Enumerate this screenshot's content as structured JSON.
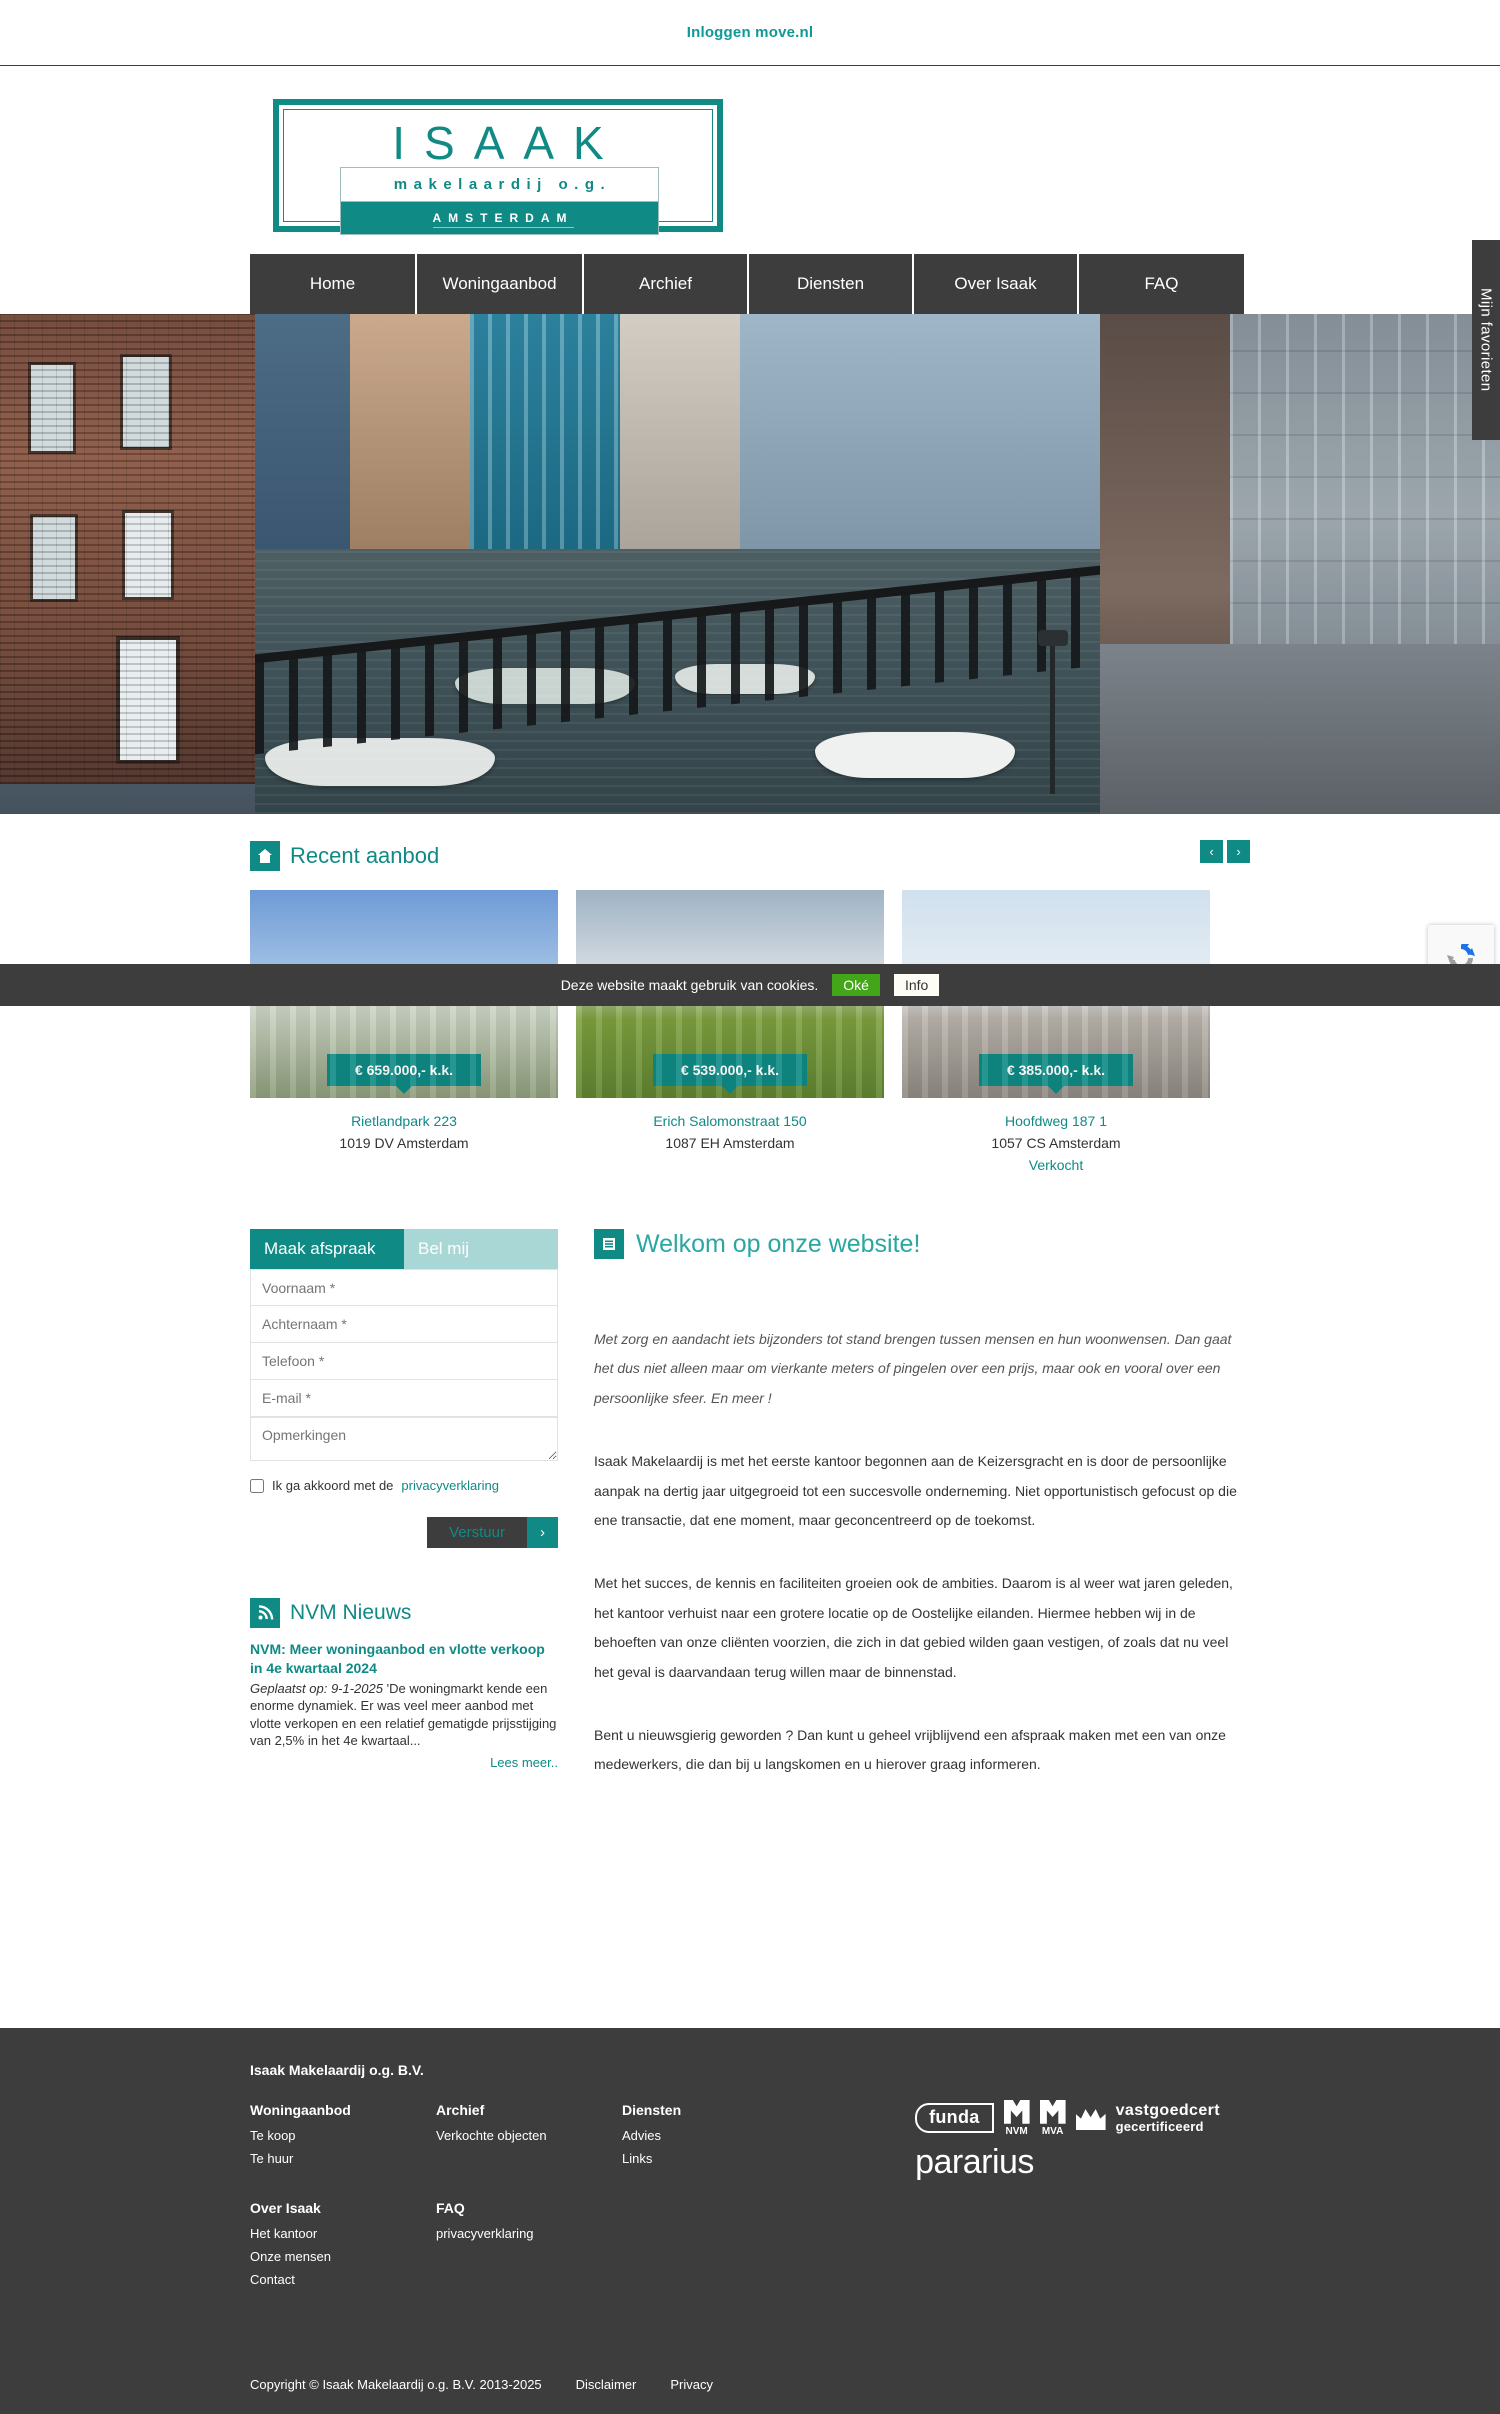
{
  "topbar": {
    "login_label": "Inloggen move.nl"
  },
  "logo": {
    "name": "ISAAK",
    "subtitle": "makelaardij o.g.",
    "city": "AMSTERDAM"
  },
  "nav": {
    "items": [
      {
        "label": "Home",
        "name": "home"
      },
      {
        "label": "Woningaanbod",
        "name": "woningaanbod"
      },
      {
        "label": "Archief",
        "name": "archief"
      },
      {
        "label": "Diensten",
        "name": "diensten"
      },
      {
        "label": "Over Isaak",
        "name": "over-isaak"
      },
      {
        "label": "FAQ",
        "name": "faq"
      }
    ],
    "favorites_label": "Mijn favorieten"
  },
  "cookiebar": {
    "message": "Deze website maakt gebruik van cookies.",
    "ok_label": "Oké",
    "info_label": "Info"
  },
  "recent": {
    "title": "Recent aanbod",
    "icon": "house-icon",
    "prev_label": "‹",
    "next_label": "›",
    "cards": [
      {
        "price": "€ 659.000,- k.k.",
        "address": "Rietlandpark 223",
        "zip": "1019 DV Amsterdam",
        "status": ""
      },
      {
        "price": "€ 539.000,- k.k.",
        "address": "Erich Salomonstraat 150",
        "zip": "1087 EH Amsterdam",
        "status": ""
      },
      {
        "price": "€ 385.000,- k.k.",
        "address": "Hoofdweg 187 1",
        "zip": "1057 CS Amsterdam",
        "status": "Verkocht"
      }
    ]
  },
  "form": {
    "tab_appointment": "Maak afspraak",
    "tab_callme": "Bel mij",
    "firstname_placeholder": "Voornaam *",
    "lastname_placeholder": "Achternaam *",
    "phone_placeholder": "Telefoon *",
    "email_placeholder": "E-mail *",
    "remarks_placeholder": "Opmerkingen",
    "agree_text": "Ik ga akkoord met de",
    "agree_link": "privacyverklaring",
    "submit_label": "Verstuur",
    "submit_arrow": "›"
  },
  "nvm_news": {
    "title": "NVM Nieuws",
    "icon": "rss-icon",
    "item_title": "NVM: Meer woningaanbod en vlotte verkoop in 4e kwartaal 2024",
    "item_meta": "Geplaatst op: 9-1-2025",
    "item_body": "'De woningmarkt kende een enorme dynamiek. Er was veel meer aanbod met vlotte verkopen en een relatief gematigde prijsstijging van 2,5% in het 4e kwartaal...",
    "read_more": "Lees meer.."
  },
  "welcome": {
    "title": "Welkom op onze website!",
    "icon": "document-lines-icon",
    "intro": "Met zorg en aandacht iets bijzonders tot stand brengen tussen mensen en hun woonwensen. Dan gaat het dus niet alleen maar om vierkante meters of pingelen over een prijs, maar ook en vooral over een persoonlijke sfeer. En meer !",
    "p1": "Isaak Makelaardij is met het eerste kantoor begonnen aan de Keizersgracht en is door de persoonlijke aanpak na dertig jaar uitgegroeid tot een succesvolle onderneming.  Niet opportunistisch gefocust op die ene transactie, dat ene moment, maar geconcentreerd op de toekomst.",
    "p2": "Met het succes, de kennis en faciliteiten groeien ook de ambities. Daarom is al weer wat jaren geleden, het  kantoor verhuist naar een grotere locatie op de Oostelijke eilanden. Hiermee hebben wij in de behoeften van onze cliënten voorzien, die zich in dat gebied wilden gaan vestigen, of zoals dat nu veel het geval is daarvandaan terug willen maar de binnenstad.",
    "p3": "Bent u nieuwsgierig geworden ? Dan kunt u geheel vrijblijvend een afspraak maken met een van onze medewerkers, die dan bij u langskomen en u hierover graag informeren."
  },
  "footer": {
    "company": "Isaak Makelaardij o.g. B.V.",
    "columns_row1": [
      {
        "heading": "Woningaanbod",
        "links": [
          "Te koop",
          "Te huur"
        ]
      },
      {
        "heading": "Archief",
        "links": [
          "Verkochte objecten"
        ]
      },
      {
        "heading": "Diensten",
        "links": [
          "Advies",
          "Links"
        ]
      }
    ],
    "columns_row2": [
      {
        "heading": "Over Isaak",
        "links": [
          "Het kantoor",
          "Onze mensen",
          "Contact"
        ]
      },
      {
        "heading": "FAQ",
        "links": [
          "privacyverklaring"
        ]
      }
    ],
    "partners": {
      "funda": "funda",
      "nvm": "NVM",
      "mva": "MVA",
      "vastgoedcert_line1": "vastgoedcert",
      "vastgoedcert_line2": "gecertificeerd",
      "pararius": "pararius"
    },
    "copyright": "Copyright © Isaak Makelaardij o.g. B.V. 2013-2025",
    "disclaimer": "Disclaimer",
    "privacy": "Privacy"
  }
}
